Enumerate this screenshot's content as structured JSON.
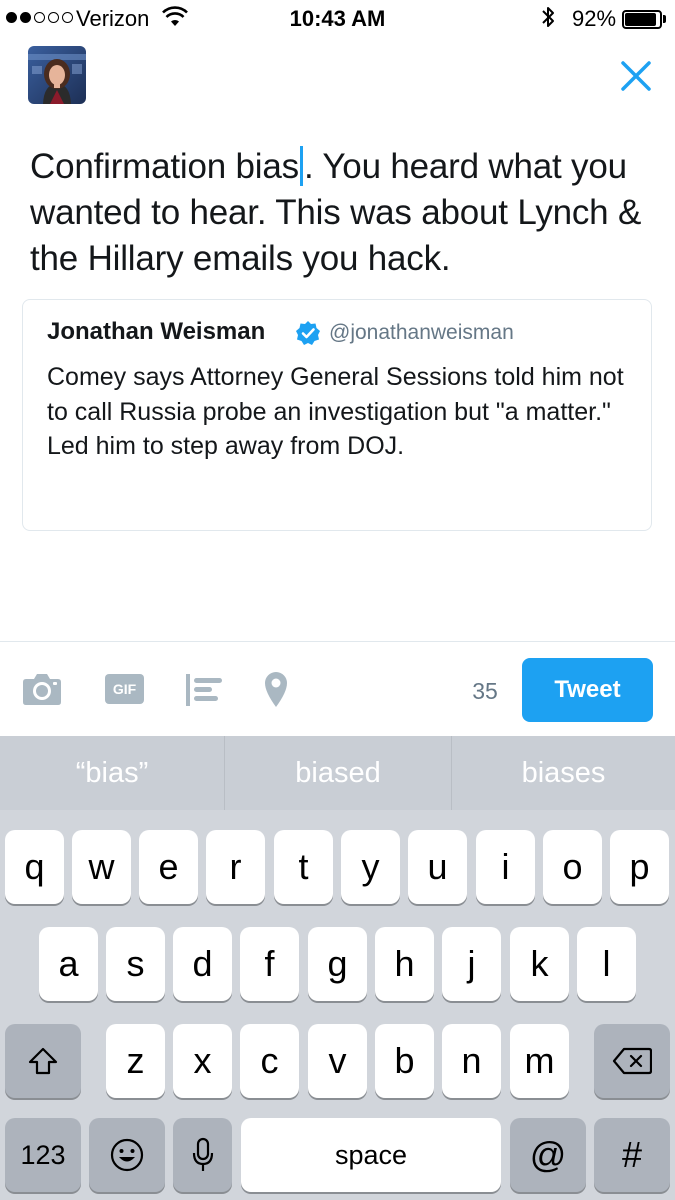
{
  "status_bar": {
    "carrier": "Verizon",
    "time": "10:43 AM",
    "battery_percent": "92%",
    "battery_level": 0.92,
    "signal_bars_filled": 2,
    "signal_bars_total": 5
  },
  "compose": {
    "text_before_cursor": "Confirmation bias",
    "text_after_cursor": ". You heard what you wanted to hear. This was about Lynch & the Hillary emails you hack."
  },
  "quoted_tweet": {
    "author_name": "Jonathan Weisman",
    "handle": "@jonathanweisman",
    "text": "Comey says Attorney General Sessions told him not to call Russia probe an investigation but \"a matter.\" Led him to step away from DOJ."
  },
  "toolbar": {
    "gif_label": "GIF",
    "char_counter": "35",
    "tweet_label": "Tweet",
    "accent_color": "#1da1f2"
  },
  "keyboard": {
    "suggestions": [
      "“bias”",
      "biased",
      "biases"
    ],
    "row1": [
      "q",
      "w",
      "e",
      "r",
      "t",
      "y",
      "u",
      "i",
      "o",
      "p"
    ],
    "row2": [
      "a",
      "s",
      "d",
      "f",
      "g",
      "h",
      "j",
      "k",
      "l"
    ],
    "row3": [
      "z",
      "x",
      "c",
      "v",
      "b",
      "n",
      "m"
    ],
    "numbers_label": "123",
    "space_label": "space",
    "at_label": "@",
    "hash_label": "#"
  }
}
